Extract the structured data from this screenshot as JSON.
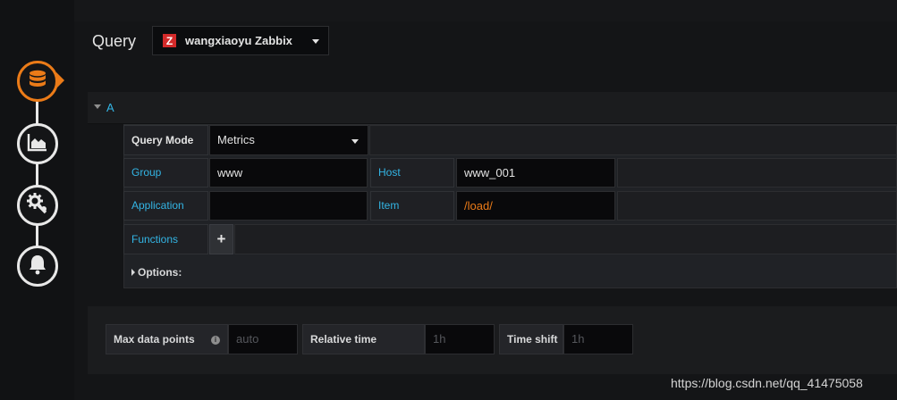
{
  "header": {
    "title": "Query"
  },
  "datasource": {
    "logo_letter": "Z",
    "name": "wangxiaoyu Zabbix"
  },
  "steps": [
    {
      "name": "queries",
      "icon": "database-icon",
      "active": true
    },
    {
      "name": "visualization",
      "icon": "chart-area-icon",
      "active": false
    },
    {
      "name": "general",
      "icon": "gears-icon",
      "active": false
    },
    {
      "name": "alert",
      "icon": "bell-icon",
      "active": false
    }
  ],
  "query": {
    "ref_id": "A",
    "mode_label": "Query Mode",
    "mode_value": "Metrics",
    "group_label": "Group",
    "group_value": "www",
    "host_label": "Host",
    "host_value": "www_001",
    "application_label": "Application",
    "application_value": "",
    "item_label": "Item",
    "item_value": "/load/",
    "functions_label": "Functions",
    "add_function": "+",
    "options_label": "Options:"
  },
  "options": {
    "max_data_points_label": "Max data points",
    "max_data_points_placeholder": "auto",
    "relative_time_label": "Relative time",
    "relative_time_placeholder": "1h",
    "time_shift_label": "Time shift",
    "time_shift_placeholder": "1h"
  },
  "watermark": "https://blog.csdn.net/qq_41475058",
  "colors": {
    "accent": "#eb7b18",
    "link": "#33b5e5",
    "brand": "#d32a2a"
  }
}
